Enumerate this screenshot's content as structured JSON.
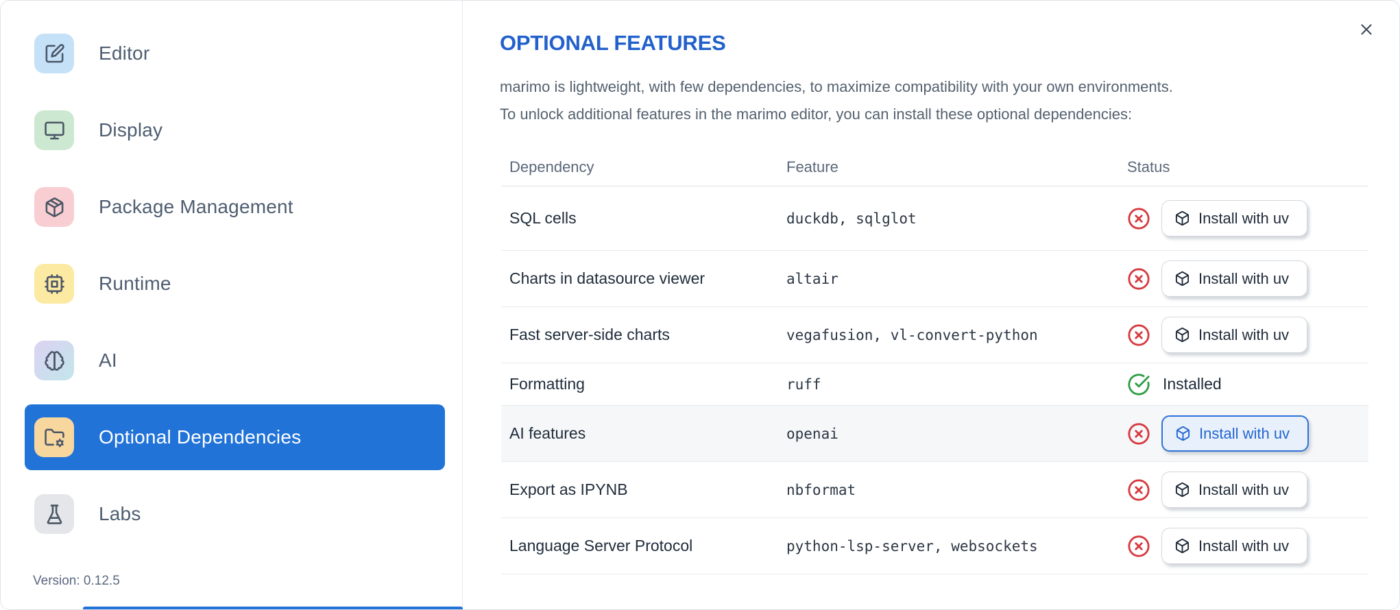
{
  "sidebar": {
    "items": [
      {
        "label": "Editor",
        "icon": "square-pen",
        "icon_bg": "#c5e1f8",
        "selected": false
      },
      {
        "label": "Display",
        "icon": "monitor",
        "icon_bg": "#cde8d0",
        "selected": false
      },
      {
        "label": "Package Management",
        "icon": "package",
        "icon_bg": "#f9ced2",
        "selected": false
      },
      {
        "label": "Runtime",
        "icon": "cpu",
        "icon_bg": "#fce9a2",
        "selected": false
      },
      {
        "label": "AI",
        "icon": "brain",
        "icon_bg": "linear-gradient(135deg,#dcd2f2,#c2e6eb)",
        "selected": false
      },
      {
        "label": "Optional Dependencies",
        "icon": "folder-cog",
        "icon_bg": "#f8d79f",
        "selected": true
      },
      {
        "label": "Labs",
        "icon": "flask",
        "icon_bg": "#e4e6e9",
        "selected": false
      }
    ],
    "version_label": "Version: 0.12.5"
  },
  "panel": {
    "title": "OPTIONAL FEATURES",
    "description_lines": [
      "marimo is lightweight, with few dependencies, to maximize compatibility with your own environments.",
      "To unlock additional features in the marimo editor, you can install these optional dependencies:"
    ],
    "table": {
      "columns": [
        "Dependency",
        "Feature",
        "Status"
      ],
      "installed_label": "Installed",
      "rows": [
        {
          "dependency": "SQL cells",
          "feature": "duckdb, sqlglot",
          "status": "missing",
          "action_label": "Install with uv",
          "highlighted": false
        },
        {
          "dependency": "Charts in datasource viewer",
          "feature": "altair",
          "status": "missing",
          "action_label": "Install with uv",
          "highlighted": false
        },
        {
          "dependency": "Fast server-side charts",
          "feature": "vegafusion, vl-convert-python",
          "status": "missing",
          "action_label": "Install with uv",
          "highlighted": false
        },
        {
          "dependency": "Formatting",
          "feature": "ruff",
          "status": "installed",
          "highlighted": false
        },
        {
          "dependency": "AI features",
          "feature": "openai",
          "status": "missing",
          "action_label": "Install with uv",
          "highlighted": true
        },
        {
          "dependency": "Export as IPYNB",
          "feature": "nbformat",
          "status": "missing",
          "action_label": "Install with uv",
          "highlighted": false
        },
        {
          "dependency": "Language Server Protocol",
          "feature": "python-lsp-server, websockets",
          "status": "missing",
          "action_label": "Install with uv",
          "highlighted": false
        }
      ]
    }
  },
  "colors": {
    "accent_blue": "#2173d8",
    "title_blue": "#2261cb",
    "error_red": "#d63a3f",
    "success_green": "#2f9e44",
    "focus_button_blue": "#2e72d6"
  }
}
